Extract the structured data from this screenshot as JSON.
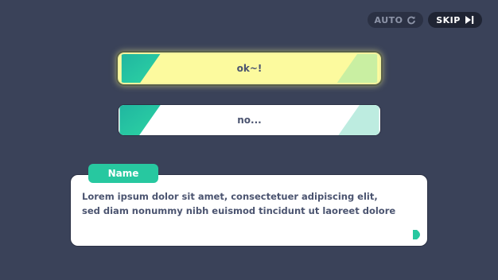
{
  "topbar": {
    "auto_label": "AUTO",
    "auto_icon": "refresh-icon",
    "skip_label": "SKIP",
    "skip_icon": "skip-forward-icon"
  },
  "choices": [
    {
      "label": "ok~!",
      "selected": true
    },
    {
      "label": "no...",
      "selected": false
    }
  ],
  "dialog": {
    "speaker_name": "Name",
    "line_1": "Lorem ipsum dolor sit amet, consectetuer adipiscing elit,",
    "line_2": "sed diam nonummy nibh euismod tincidunt ut laoreet dolore",
    "advance_icon": "play-triangle-icon"
  },
  "colors": {
    "background": "#3a4259",
    "accent": "#27c8a0",
    "selected_choice": "#fcfa9e",
    "text": "#4b5470"
  }
}
